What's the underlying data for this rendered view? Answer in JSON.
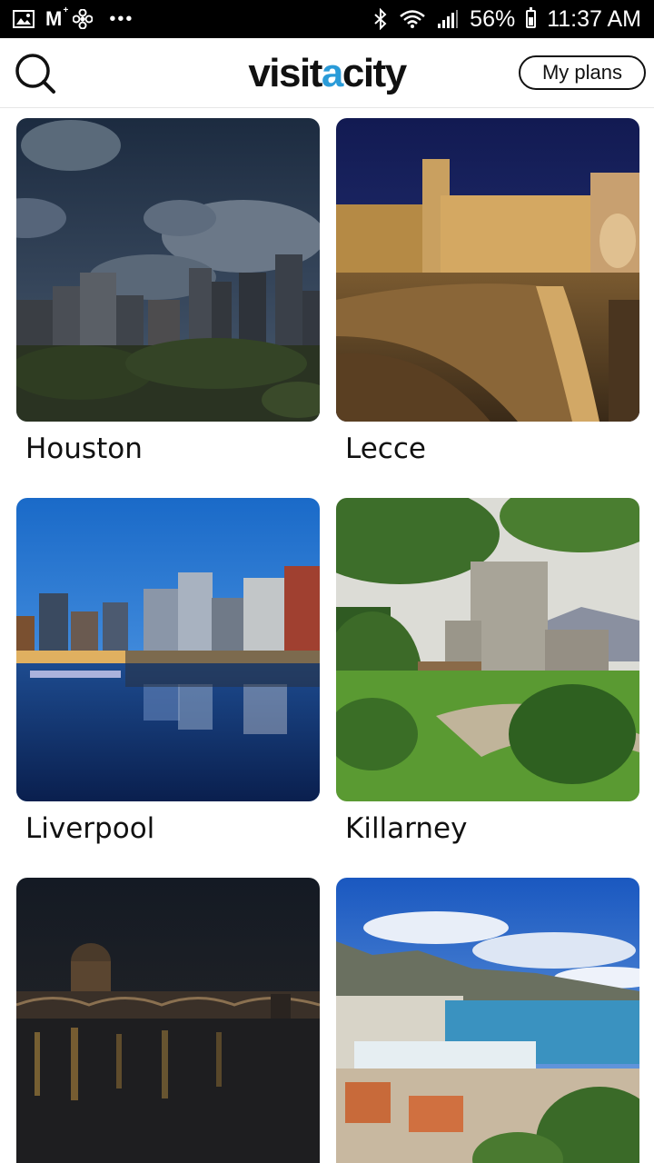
{
  "status_bar": {
    "time": "11:37 AM",
    "battery": "56%",
    "left_icons": [
      "gallery-icon",
      "gmail-icon",
      "fan-icon",
      "more-dots-icon"
    ],
    "right_icons": [
      "bluetooth-icon",
      "wifi-icon",
      "signal-icon",
      "battery-icon"
    ]
  },
  "header": {
    "logo_prefix": "visit",
    "logo_accent": "a",
    "logo_suffix": "city",
    "my_plans_label": "My plans",
    "search_icon": "search-icon",
    "accent_color": "#2a9bd8"
  },
  "cities": [
    {
      "name": "Houston"
    },
    {
      "name": "Lecce"
    },
    {
      "name": "Liverpool"
    },
    {
      "name": "Killarney"
    },
    {
      "name": ""
    },
    {
      "name": ""
    }
  ]
}
